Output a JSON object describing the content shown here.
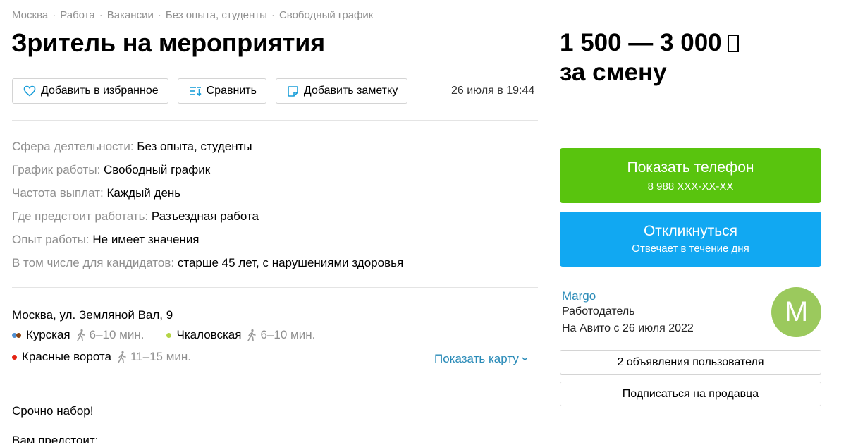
{
  "breadcrumb": [
    "Москва",
    "Работа",
    "Вакансии",
    "Без опыта, студенты",
    "Свободный график"
  ],
  "breadcrumb_separator": "·",
  "title": "Зритель на мероприятия",
  "actions": {
    "favorite": "Добавить в избранное",
    "compare": "Сравнить",
    "note": "Добавить заметку"
  },
  "date": "26 июля в 19:44",
  "params": [
    {
      "key": "Сфера деятельности:",
      "value": "Без опыта, студенты"
    },
    {
      "key": "График работы:",
      "value": "Свободный график"
    },
    {
      "key": "Частота выплат:",
      "value": "Каждый день"
    },
    {
      "key": "Где предстоит работать:",
      "value": "Разъездная работа"
    },
    {
      "key": "Опыт работы:",
      "value": "Не имеет значения"
    },
    {
      "key": "В том числе для кандидатов:",
      "value": "старше 45 лет, с нарушениями здоровья"
    }
  ],
  "address": "Москва, ул. Земляной Вал, 9",
  "metro": [
    {
      "name": "Курская",
      "time": "6–10 мин.",
      "colors": [
        "#4f8fd1",
        "#8b4513"
      ]
    },
    {
      "name": "Чкаловская",
      "time": "6–10 мин.",
      "colors": [
        "#b4d445"
      ]
    },
    {
      "name": "Красные ворота",
      "time": "11–15 мин.",
      "colors": [
        "#e42313"
      ]
    }
  ],
  "show_map": "Показать карту",
  "description": {
    "line1": "Срочно набор!",
    "line2": "Вам предстоит:"
  },
  "price": {
    "amount": "1 500 — 3 000",
    "period": "за смену"
  },
  "phone_button": {
    "label": "Показать телефон",
    "number": "8 988 XXX-XX-XX",
    "color": "#59c40e"
  },
  "respond_button": {
    "label": "Откликнуться",
    "sub": "Отвечает в течение дня",
    "color": "#11a8f2"
  },
  "seller": {
    "name": "Margo",
    "role": "Работодатель",
    "since": "На Авито с 26 июля 2022",
    "avatar_letter": "M",
    "avatar_color": "#9bc95d"
  },
  "seller_ads": "2 объявления пользователя",
  "subscribe": "Подписаться на продавца"
}
